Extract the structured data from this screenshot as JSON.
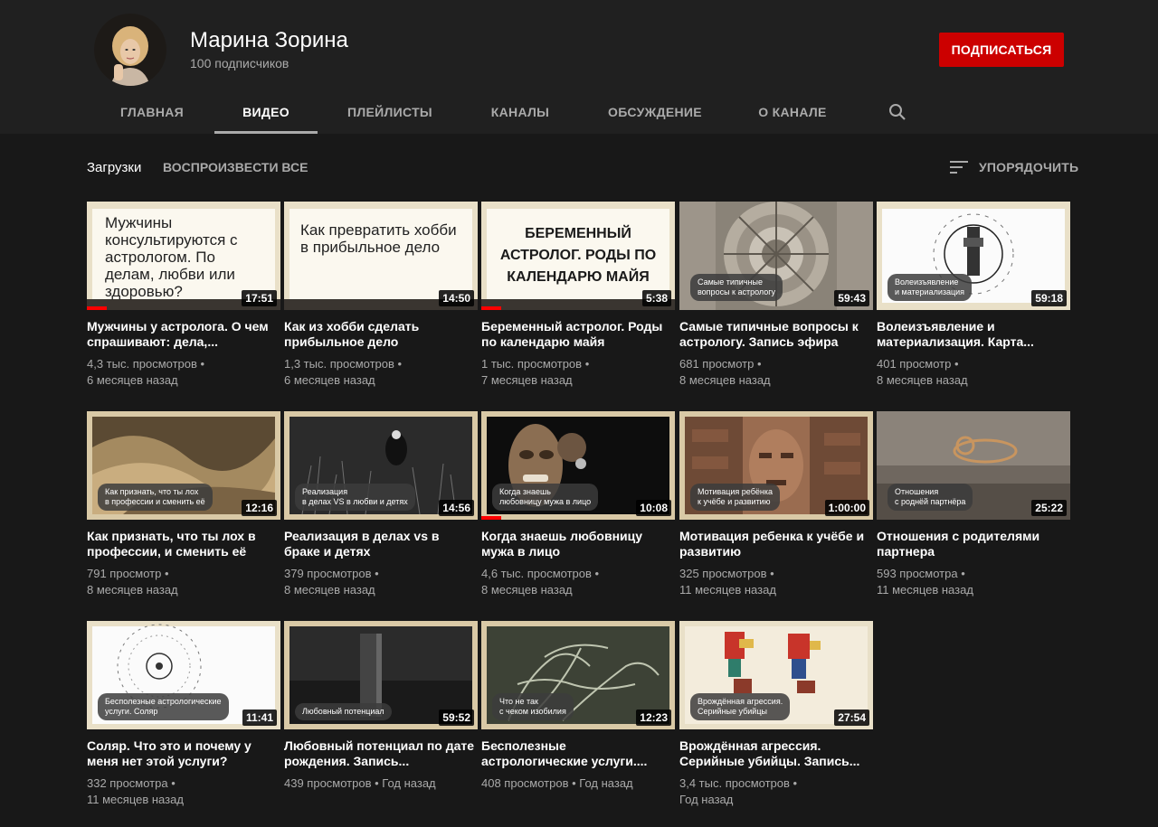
{
  "channel": {
    "name": "Марина Зорина",
    "subscribers": "100 подписчиков",
    "subscribe_label": "ПОДПИСАТЬСЯ"
  },
  "tabs": [
    {
      "label": "ГЛАВНАЯ"
    },
    {
      "label": "ВИДЕО"
    },
    {
      "label": "ПЛЕЙЛИСТЫ"
    },
    {
      "label": "КАНАЛЫ"
    },
    {
      "label": "ОБСУЖДЕНИЕ"
    },
    {
      "label": "О КАНАЛЕ"
    }
  ],
  "active_tab": "ВИДЕО",
  "section": {
    "title": "Загрузки",
    "play_all": "ВОСПРОИЗВЕСТИ ВСЕ",
    "sort_label": "УПОРЯДОЧИТЬ"
  },
  "videos": [
    {
      "title": "Мужчины у астролога. О чем спрашивают: дела,...",
      "views": "4,3 тыс. просмотров",
      "age": "6 месяцев назад",
      "duration": "17:51",
      "slide_text": "Мужчины консультируются с астрологом. По делам, любви или здоровью?",
      "pill": "",
      "progress": 0.1
    },
    {
      "title": "Как из хобби сделать прибыльное дело",
      "views": "1,3 тыс. просмотров",
      "age": "6 месяцев назад",
      "duration": "14:50",
      "slide_text": "Как превратить хобби в прибыльное дело",
      "pill": "",
      "progress": 0.0
    },
    {
      "title": "Беременный астролог. Роды по календарю майя",
      "views": "1 тыс. просмотров",
      "age": "7 месяцев назад",
      "duration": "5:38",
      "slide_text": "БЕРЕМЕННЫЙ АСТРОЛОГ. РОДЫ ПО КАЛЕНДАРЮ МАЙЯ",
      "pill": "",
      "progress": 0.1
    },
    {
      "title": "Самые типичные вопросы к астрологу. Запись эфира",
      "views": "681 просмотр",
      "age": "8 месяцев назад",
      "duration": "59:43",
      "slide_text": "",
      "pill": "Самые типичные\nвопросы к астрологу",
      "progress": 0.0
    },
    {
      "title": "Волеизъявление и материализация. Карта...",
      "views": "401 просмотр",
      "age": "8 месяцев назад",
      "duration": "59:18",
      "slide_text": "",
      "pill": "Волеизъявление\nи материализация",
      "progress": 0.0
    },
    {
      "title": "Как признать, что ты лох в профессии, и сменить её",
      "views": "791 просмотр",
      "age": "8 месяцев назад",
      "duration": "12:16",
      "slide_text": "",
      "pill": "Как признать, что ты лох\nв профессии и сменить её",
      "progress": 0.0
    },
    {
      "title": "Реализация в делах vs в браке и детях",
      "views": "379 просмотров",
      "age": "8 месяцев назад",
      "duration": "14:56",
      "slide_text": "",
      "pill": "Реализация\nв делах VS в любви и детях",
      "progress": 0.0
    },
    {
      "title": "Когда знаешь любовницу мужа в лицо",
      "views": "4,6 тыс. просмотров",
      "age": "8 месяцев назад",
      "duration": "10:08",
      "slide_text": "",
      "pill": "Когда знаешь\nлюбовницу мужа в лицо",
      "progress": 0.1
    },
    {
      "title": "Мотивация ребенка к учёбе и развитию",
      "views": "325 просмотров",
      "age": "11 месяцев назад",
      "duration": "1:00:00",
      "slide_text": "",
      "pill": "Мотивация ребёнка\nк учёбе и развитию",
      "progress": 0.0
    },
    {
      "title": "Отношения с родителями партнера",
      "views": "593 просмотра",
      "age": "11 месяцев назад",
      "duration": "25:22",
      "slide_text": "",
      "pill": "Отношения\nс роднёй партнёра",
      "progress": 0.0
    },
    {
      "title": "Соляр. Что это и почему у меня нет этой услуги?",
      "views": "332 просмотра",
      "age": "11 месяцев назад",
      "duration": "11:41",
      "slide_text": "",
      "pill": "Бесполезные астрологические\nуслуги. Соляр",
      "progress": 0.0
    },
    {
      "title": "Любовный потенциал по дате рождения. Запись...",
      "views": "439 просмотров",
      "age": "Год назад",
      "duration": "59:52",
      "slide_text": "",
      "pill": "Любовный потенциал",
      "progress": 0.0
    },
    {
      "title": "Бесполезные астрологические услуги....",
      "views": "408 просмотров",
      "age": "Год назад",
      "duration": "12:23",
      "slide_text": "",
      "pill": "Что не так\nс чеком изобилия",
      "progress": 0.0
    },
    {
      "title": "Врождённая агрессия. Серийные убийцы. Запись...",
      "views": "3,4 тыс. просмотров",
      "age": "Год назад",
      "duration": "27:54",
      "slide_text": "",
      "pill": "Врождённая агрессия.\nСерийные убийцы",
      "progress": 0.0
    }
  ],
  "colors": {
    "subscribe": "#cc0000",
    "progress": "#ff0000",
    "header_bg": "#202020",
    "page_bg": "#181818"
  }
}
